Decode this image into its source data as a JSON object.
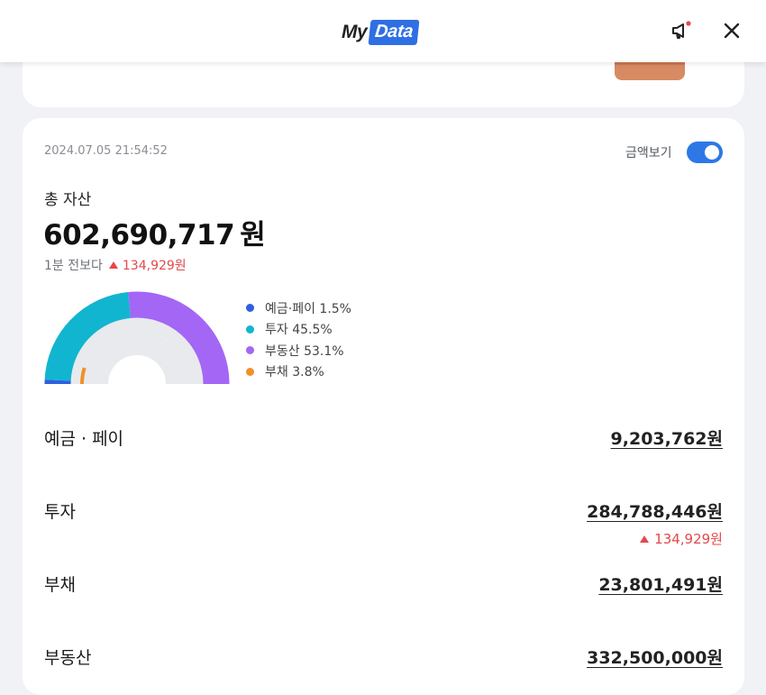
{
  "header": {
    "logo_my": "My",
    "logo_data": "Data"
  },
  "card": {
    "timestamp": "2024.07.05 21:54:52",
    "toggle_label": "금액보기",
    "toggle_on": true,
    "total_label": "총 자산",
    "total_value": "602,690,717",
    "total_unit": "원",
    "change_label": "1분 전보다",
    "change_value": "134,929원"
  },
  "legend": [
    {
      "label": "예금·페이 1.5%",
      "color": "#2f5fe0"
    },
    {
      "label": "투자 45.5%",
      "color": "#12b5cf"
    },
    {
      "label": "부동산 53.1%",
      "color": "#a466f5"
    },
    {
      "label": "부채 3.8%",
      "color": "#f0902a"
    }
  ],
  "chart_data": {
    "type": "pie",
    "categories": [
      "예금·페이",
      "투자",
      "부동산",
      "부채"
    ],
    "values": [
      1.5,
      45.5,
      53.1,
      3.8
    ],
    "colors": [
      "#2f5fe0",
      "#12b5cf",
      "#a466f5",
      "#f0902a"
    ]
  },
  "rows": [
    {
      "label": "예금 · 페이",
      "value": "9,203,762원"
    },
    {
      "label": "투자",
      "value": "284,788,446원",
      "change": "134,929원"
    },
    {
      "label": "부채",
      "value": "23,801,491원"
    },
    {
      "label": "부동산",
      "value": "332,500,000원"
    }
  ]
}
